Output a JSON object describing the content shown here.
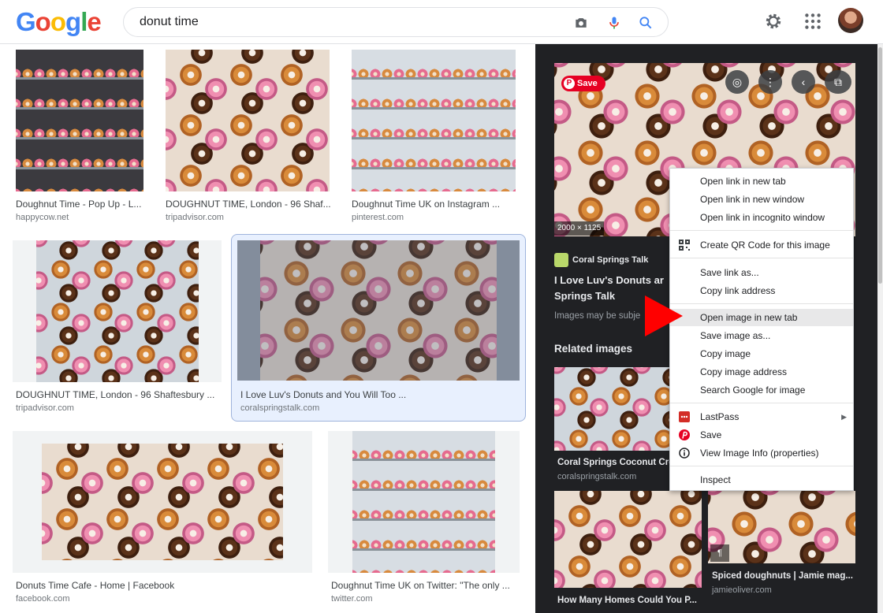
{
  "header": {
    "logo_letters": [
      {
        "ch": "G",
        "color": "#4285F4"
      },
      {
        "ch": "o",
        "color": "#EA4335"
      },
      {
        "ch": "o",
        "color": "#FBBC05"
      },
      {
        "ch": "g",
        "color": "#4285F4"
      },
      {
        "ch": "l",
        "color": "#34A853"
      },
      {
        "ch": "e",
        "color": "#EA4335"
      }
    ],
    "search_query": "donut time",
    "icons": [
      "camera-icon",
      "microphone-icon",
      "search-icon",
      "gear-icon",
      "apps-icon"
    ]
  },
  "results": [
    {
      "title": "Doughnut Time - Pop Up - L...",
      "source": "happycow.net"
    },
    {
      "title": "DOUGHNUT TIME, London - 96 Shaf...",
      "source": "tripadvisor.com"
    },
    {
      "title": "Doughnut Time UK on Instagram ...",
      "source": "pinterest.com"
    },
    {
      "title": "DOUGHNUT TIME, London - 96 Shaftesbury ...",
      "source": "tripadvisor.com"
    },
    {
      "title": "I Love Luv's Donuts and You Will Too ...",
      "source": "coralspringstalk.com"
    },
    {
      "title": "Donuts Time Cafe - Home | Facebook",
      "source": "facebook.com"
    },
    {
      "title": "Doughnut Time UK on Twitter: \"The only ...",
      "source": "twitter.com"
    }
  ],
  "panel": {
    "save_label": "Save",
    "save_glyph": "P",
    "dimensions": "2000 × 1125",
    "site_name": "Coral Springs Talk",
    "title": "I Love Luv's Donuts ar Springs Talk",
    "subtitle": "Images may be subje",
    "related_heading": "Related images",
    "related": [
      {
        "title": "Coral Springs Coconut Cre",
        "source": "coralspringstalk.com"
      },
      {
        "title": "How Many Homes Could You P...",
        "source": ""
      },
      {
        "title": "Spiced doughnuts | Jamie mag...",
        "source": "jamieoliver.com"
      }
    ],
    "badge_glyph": "¶"
  },
  "context_menu": {
    "items": [
      {
        "label": "Open link in new tab"
      },
      {
        "label": "Open link in new window"
      },
      {
        "label": "Open link in incognito window"
      },
      {
        "label": "Create QR Code for this image",
        "icon": "qr-code-icon"
      },
      {
        "label": "Save link as..."
      },
      {
        "label": "Copy link address"
      },
      {
        "label": "Open image in new tab",
        "highlighted": true
      },
      {
        "label": "Save image as..."
      },
      {
        "label": "Copy image"
      },
      {
        "label": "Copy image address"
      },
      {
        "label": "Search Google for image"
      },
      {
        "label": "LastPass",
        "icon": "lastpass-icon",
        "submenu": true
      },
      {
        "label": "Save",
        "icon": "pinterest-icon"
      },
      {
        "label": "View Image Info (properties)",
        "icon": "info-icon"
      },
      {
        "label": "Inspect"
      }
    ],
    "submenu_glyph": "▶"
  },
  "colors": {
    "panel_bg": "#202124",
    "pinterest_red": "#E60023",
    "pointer_red": "#FF0000",
    "selected_card": "#E8F0FE",
    "lastpass_red": "#D32D27"
  }
}
